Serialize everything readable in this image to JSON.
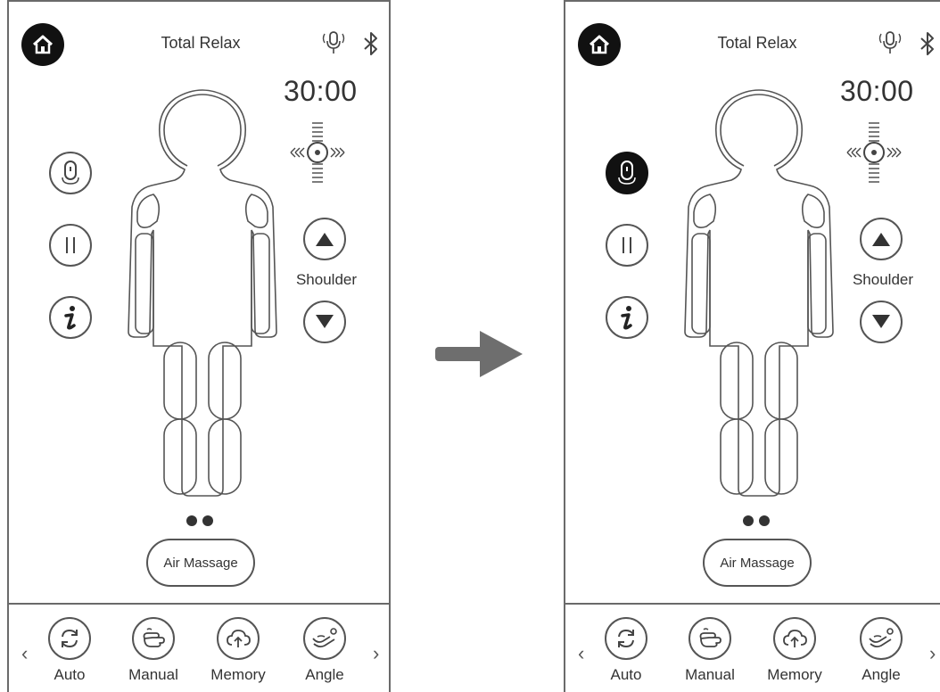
{
  "screens": [
    {
      "title": "Total Relax",
      "timer": "30:00",
      "shoulder_label": "Shoulder",
      "air_massage_label": "Air Massage",
      "mic_button_active": false,
      "modes": [
        {
          "label": "Auto",
          "icon": "auto-cycle-icon"
        },
        {
          "label": "Manual",
          "icon": "manual-hand-icon"
        },
        {
          "label": "Memory",
          "icon": "memory-cloud-icon"
        },
        {
          "label": "Angle",
          "icon": "angle-recline-icon"
        }
      ],
      "nav_prev": "‹",
      "nav_next": "›"
    },
    {
      "title": "Total Relax",
      "timer": "30:00",
      "shoulder_label": "Shoulder",
      "air_massage_label": "Air Massage",
      "mic_button_active": true,
      "modes": [
        {
          "label": "Auto",
          "icon": "auto-cycle-icon"
        },
        {
          "label": "Manual",
          "icon": "manual-hand-icon"
        },
        {
          "label": "Memory",
          "icon": "memory-cloud-icon"
        },
        {
          "label": "Angle",
          "icon": "angle-recline-icon"
        }
      ],
      "nav_prev": "‹",
      "nav_next": "›"
    }
  ],
  "colors": {
    "outline": "#555555",
    "filled": "#111111",
    "arrow": "#6e6e6e"
  }
}
